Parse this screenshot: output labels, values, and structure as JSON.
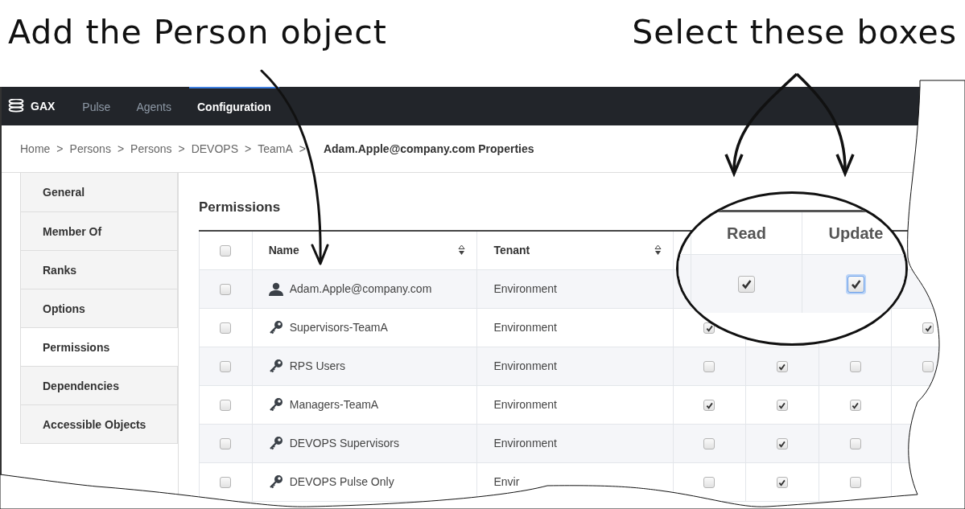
{
  "annotations": [
    {
      "text": "Add the Person object"
    },
    {
      "text": "Select these boxes"
    }
  ],
  "nav": {
    "brand": "GAX",
    "items": [
      {
        "label": "Pulse",
        "selected": false
      },
      {
        "label": "Agents",
        "selected": false
      },
      {
        "label": "Configuration",
        "selected": true
      }
    ]
  },
  "breadcrumb": [
    {
      "kind": "link",
      "text": "Home"
    },
    {
      "kind": "separator",
      "text": ">"
    },
    {
      "kind": "link",
      "text": "Persons"
    },
    {
      "kind": "separator",
      "text": ">"
    },
    {
      "kind": "link",
      "text": "Persons"
    },
    {
      "kind": "separator",
      "text": ">"
    },
    {
      "kind": "link",
      "text": "DEVOPS"
    },
    {
      "kind": "separator",
      "text": ">"
    },
    {
      "kind": "link",
      "text": "TeamA"
    },
    {
      "kind": "separator",
      "text": ">"
    },
    {
      "kind": "current",
      "text": "Adam.Apple@company.com Properties"
    }
  ],
  "sidebar": {
    "items": [
      {
        "label": "General",
        "selected": false
      },
      {
        "label": "Member Of",
        "selected": false
      },
      {
        "label": "Ranks",
        "selected": false
      },
      {
        "label": "Options",
        "selected": false
      },
      {
        "label": "Permissions",
        "selected": true
      },
      {
        "label": "Dependencies",
        "selected": false
      },
      {
        "label": "Accessible Objects",
        "selected": false
      }
    ]
  },
  "panel": {
    "title": "Permissions"
  },
  "table": {
    "select_all": {
      "checked": false
    },
    "columns": [
      {
        "label": "Name",
        "sortable": true
      },
      {
        "label": "Tenant",
        "sortable": true
      }
    ],
    "rows": [
      {
        "kind": "person",
        "name": "Adam.Apple@company.com",
        "tenant": "Environment",
        "checked": false
      },
      {
        "kind": "access-group",
        "name": "Supervisors-TeamA",
        "tenant": "Environment",
        "checked": false,
        "permissions": {
          "column_1": true,
          "column_4": true
        }
      },
      {
        "kind": "access-group",
        "name": "RPS Users",
        "tenant": "Environment",
        "checked": false,
        "permissions": {
          "column_1": false,
          "column_2": true,
          "column_3": false,
          "column_4": false
        }
      },
      {
        "kind": "access-group",
        "name": "Managers-TeamA",
        "tenant": "Environment",
        "checked": false,
        "permissions": {
          "column_1": true,
          "column_2": true,
          "column_3": true
        }
      },
      {
        "kind": "access-group",
        "name": "DEVOPS Supervisors",
        "tenant": "Environment",
        "checked": false,
        "permissions": {
          "column_1": false,
          "column_2": true,
          "column_3": false
        }
      },
      {
        "kind": "access-group",
        "name": "DEVOPS Pulse Only",
        "tenant": "Envir",
        "checked": false,
        "permissions": {
          "column_1": false,
          "column_2": true,
          "column_3": false
        }
      }
    ]
  },
  "callout": {
    "columns": [
      {
        "label": "Read",
        "checked": true,
        "focused": false
      },
      {
        "label": "Update",
        "checked": true,
        "focused": true
      }
    ]
  }
}
